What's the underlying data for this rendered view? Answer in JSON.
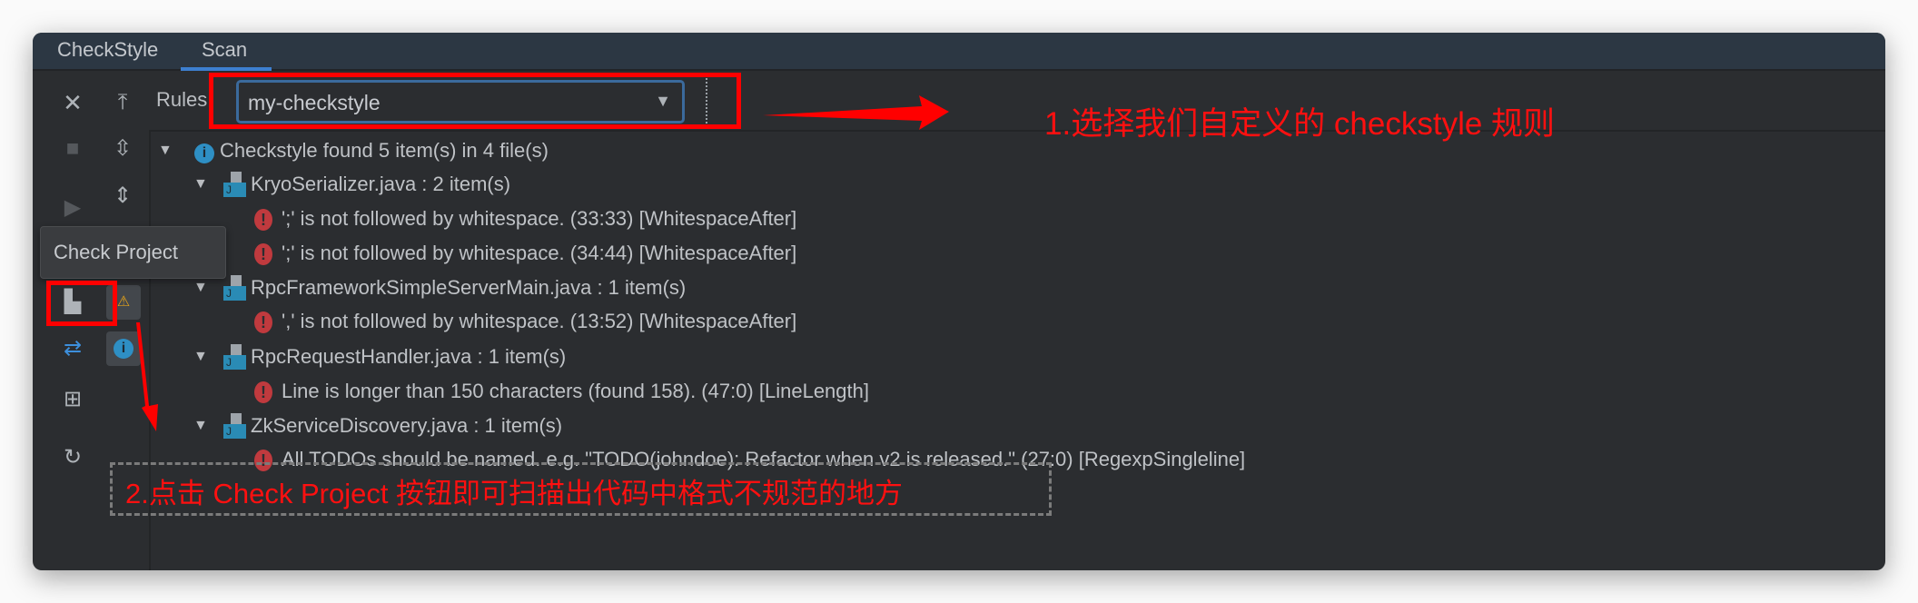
{
  "tabs": [
    {
      "label": "CheckStyle",
      "active": false
    },
    {
      "label": "Scan",
      "active": true
    }
  ],
  "toolbar": {
    "rules_label": "Rules:",
    "rules_value": "my-checkstyle"
  },
  "tooltip": "Check Project",
  "tree": {
    "summary": "Checkstyle found 5 item(s) in 4 file(s)",
    "files": [
      {
        "name": "KryoSerializer.java : 2 item(s)",
        "items": [
          "';' is not followed by whitespace. (33:33) [WhitespaceAfter]",
          "';' is not followed by whitespace. (34:44) [WhitespaceAfter]"
        ]
      },
      {
        "name": "RpcFrameworkSimpleServerMain.java : 1 item(s)",
        "items": [
          "',' is not followed by whitespace. (13:52) [WhitespaceAfter]"
        ]
      },
      {
        "name": "RpcRequestHandler.java : 1 item(s)",
        "items": [
          "Line is longer than 150 characters (found 158). (47:0) [LineLength]"
        ]
      },
      {
        "name": "ZkServiceDiscovery.java : 1 item(s)",
        "items": [
          "All TODOs should be named.  e.g. \"TODO(johndoe): Refactor when v2 is released.\" (27:0) [RegexpSingleline]"
        ]
      }
    ]
  },
  "annotations": {
    "step1": "1.选择我们自定义的 checkstyle 规则",
    "step2": "2.点击 Check Project 按钮即可扫描出代码中格式不规范的地方"
  },
  "colors": {
    "annotation": "#ff0000",
    "accent": "#3d7fd0",
    "error": "#c03a3e",
    "info": "#2e8fc4",
    "warning": "#e3a21a"
  }
}
